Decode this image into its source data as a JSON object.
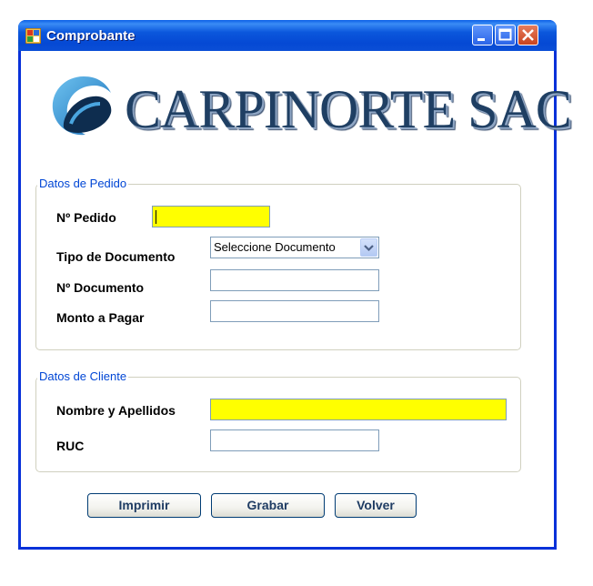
{
  "window": {
    "title": "Comprobante"
  },
  "logo": {
    "text": "CARPINORTE SAC"
  },
  "pedido_group": {
    "legend": "Datos de Pedido",
    "nro_pedido_label": "Nº Pedido",
    "nro_pedido_value": "",
    "tipo_documento_label": "Tipo de Documento",
    "tipo_documento_selected": "Seleccione Documento",
    "nro_documento_label": "Nº Documento",
    "nro_documento_value": "",
    "monto_label": "Monto a Pagar",
    "monto_value": ""
  },
  "cliente_group": {
    "legend": "Datos de Cliente",
    "nombre_label": "Nombre y Apellidos",
    "nombre_value": "",
    "ruc_label": "RUC",
    "ruc_value": ""
  },
  "buttons": {
    "imprimir": "Imprimir",
    "grabar": "Grabar",
    "volver": "Volver"
  },
  "colors": {
    "highlight_field": "#ffff00",
    "legend": "#0046d5",
    "titlebar": "#0b57dc"
  }
}
